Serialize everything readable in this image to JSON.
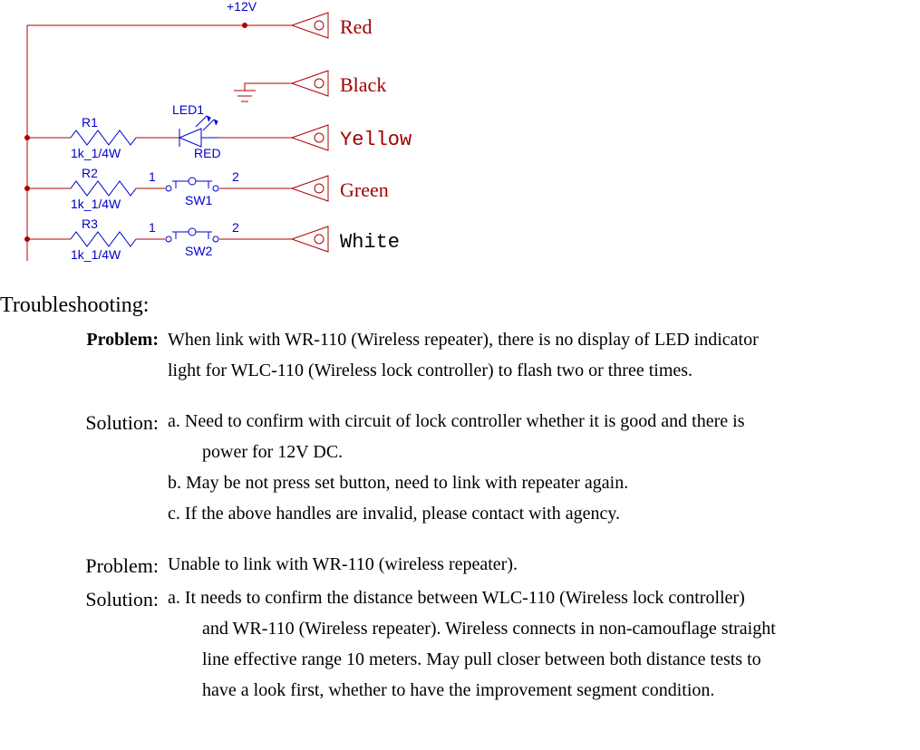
{
  "diagram": {
    "voltage_label": "+12V",
    "wires": [
      {
        "color": "Red"
      },
      {
        "color": "Black"
      },
      {
        "color": "Yellow"
      },
      {
        "color": "Green"
      },
      {
        "color": "White"
      }
    ],
    "components": {
      "r1": {
        "ref": "R1",
        "value": "1k_1/4W"
      },
      "r2": {
        "ref": "R2",
        "value": "1k_1/4W"
      },
      "r3": {
        "ref": "R3",
        "value": "1k_1/4W"
      },
      "led1": {
        "ref": "LED1",
        "color_label": "RED"
      },
      "sw1": {
        "ref": "SW1",
        "pin1": "1",
        "pin2": "2"
      },
      "sw2": {
        "ref": "SW2",
        "pin1": "1",
        "pin2": "2"
      }
    }
  },
  "section_heading": "Troubleshooting:",
  "block1": {
    "problem_label": "Problem:",
    "problem_text_a": "When link with WR-110 (Wireless repeater), there is no display of LED indicator",
    "problem_text_b": "light for WLC-110 (Wireless lock controller) to flash two or three times.",
    "solution_label": "Solution:",
    "sol_a_1": "a. Need to confirm with circuit of lock controller whether it is good and there is",
    "sol_a_2": "power for 12V DC.",
    "sol_b": "b. May be not press set button, need to link with repeater again.",
    "sol_c": "c. If the above handles are invalid, please contact with agency."
  },
  "block2": {
    "problem_label": "Problem:",
    "problem_text": "Unable to link with WR-110 (wireless repeater).",
    "solution_label": "Solution:",
    "sol_a_1": "a. It needs to confirm the distance between WLC-110 (Wireless lock controller)",
    "sol_a_2": "and WR-110 (Wireless repeater). Wireless connects in non-camouflage straight",
    "sol_a_3": "line effective range 10 meters. May pull closer between both distance tests to",
    "sol_a_4": "have a look first, whether to have the improvement segment condition."
  }
}
